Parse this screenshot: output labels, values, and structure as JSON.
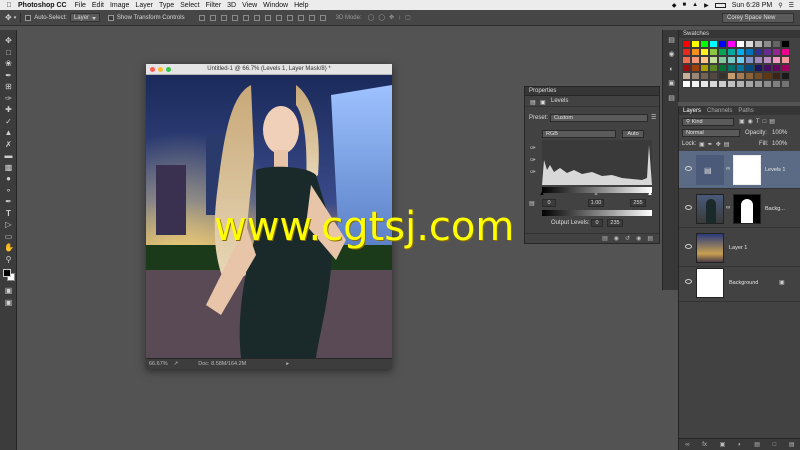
{
  "menubar": {
    "app": "Photoshop CC",
    "items": [
      "File",
      "Edit",
      "Image",
      "Layer",
      "Type",
      "Select",
      "Filter",
      "3D",
      "View",
      "Window",
      "Help"
    ],
    "clock": "Sun 6:28 PM"
  },
  "options": {
    "auto_select_label": "Auto-Select:",
    "auto_select_value": "Layer",
    "transform_label": "Show Transform Controls",
    "mode_3d": "3D Mode:",
    "workspace": "Corey Space New"
  },
  "document": {
    "title": "Untitled-1 @ 66.7% (Levels 1, Layer Mask/8) *",
    "zoom": "66.67%",
    "doc_info": "Doc: 8.58M/164.2M"
  },
  "properties": {
    "tab": "Properties",
    "header": "Levels",
    "preset_label": "Preset:",
    "preset_value": "Custom",
    "channel": "RGB",
    "auto_label": "Auto",
    "input_black": "0",
    "input_mid": "1.00",
    "input_white": "255",
    "output_label": "Output Levels:",
    "output_black": "0",
    "output_white": "235"
  },
  "swatches": {
    "tab": "Swatches",
    "colors": [
      "#ff0000",
      "#ffff00",
      "#00ff00",
      "#00ffff",
      "#0000ff",
      "#ff00ff",
      "#ffffff",
      "#dcdcdc",
      "#b4b4b4",
      "#8c8c8c",
      "#646464",
      "#000000",
      "#e8281e",
      "#f5901e",
      "#fff21e",
      "#8cc63e",
      "#00a651",
      "#00a99d",
      "#00aeef",
      "#0072bc",
      "#2e3192",
      "#662d91",
      "#92278f",
      "#ec008c",
      "#f26c4f",
      "#f7977a",
      "#fdc689",
      "#c4df9b",
      "#82ca9c",
      "#7accc8",
      "#6dcff6",
      "#8393ca",
      "#a187be",
      "#bc8dbf",
      "#f49ac1",
      "#f5989d",
      "#9e0b0f",
      "#a0410d",
      "#aba000",
      "#598527",
      "#007236",
      "#00746b",
      "#0076a3",
      "#004a80",
      "#1b1464",
      "#440e62",
      "#630460",
      "#9e005d",
      "#c7b299",
      "#998675",
      "#736357",
      "#534741",
      "#37302d",
      "#c69c6d",
      "#a67c52",
      "#8c6239",
      "#754c24",
      "#603913",
      "#3c2415",
      "#1a1a1a",
      "#ffffff",
      "#f2f2f2",
      "#e6e6e6",
      "#d9d9d9",
      "#cccccc",
      "#bfbfbf",
      "#b3b3b3",
      "#a6a6a6",
      "#999999",
      "#8c8c8c",
      "#808080",
      "#737373"
    ]
  },
  "layers": {
    "tabs": [
      "Layers",
      "Channels",
      "Paths"
    ],
    "kind_label": "Kind",
    "blend_mode": "Normal",
    "opacity_label": "Opacity:",
    "opacity_value": "100%",
    "lock_label": "Lock:",
    "fill_label": "Fill:",
    "fill_value": "100%",
    "items": [
      {
        "name": "Levels 1",
        "selected": true
      },
      {
        "name": "Backg...",
        "selected": false
      },
      {
        "name": "Layer 1",
        "selected": false
      },
      {
        "name": "Background",
        "selected": false
      }
    ]
  },
  "watermark": "www.cgtsj.com"
}
